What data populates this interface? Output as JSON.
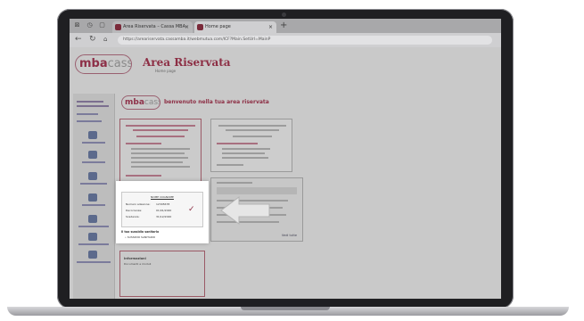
{
  "browser": {
    "tabs": [
      {
        "label": "Area Riservata – Cassa MBA"
      },
      {
        "label": "Home page"
      }
    ],
    "new_tab": "+",
    "url": "https://areariservata.cassamba.it/webmutua.com/ICF?Main.SetUrl=MainP"
  },
  "header": {
    "logo_main": "mba",
    "logo_suffix": "cassa",
    "title": "Area Riservata",
    "subtitle": "Home page"
  },
  "content": {
    "logo_main": "mba",
    "logo_suffix": "cassa",
    "welcome": "benvenuto nella tua area riservata"
  },
  "highlight_card": {
    "inner_title": "NOME COGNOME",
    "rows": [
      {
        "label": "Numero adesione:",
        "value": "12345678"
      },
      {
        "label": "Decorrenza:",
        "value": "01/01/2020"
      },
      {
        "label": "Scadenza:",
        "value": "31/12/2020"
      }
    ],
    "question": "Il tuo sussidio sanitario",
    "plan": "• SUSSIDIO SANITARIO"
  },
  "bottom_card": {
    "title": "Informazioni",
    "subtitle": "Documenti e moduli"
  },
  "right_card": {
    "link": "Vedi tutte"
  }
}
